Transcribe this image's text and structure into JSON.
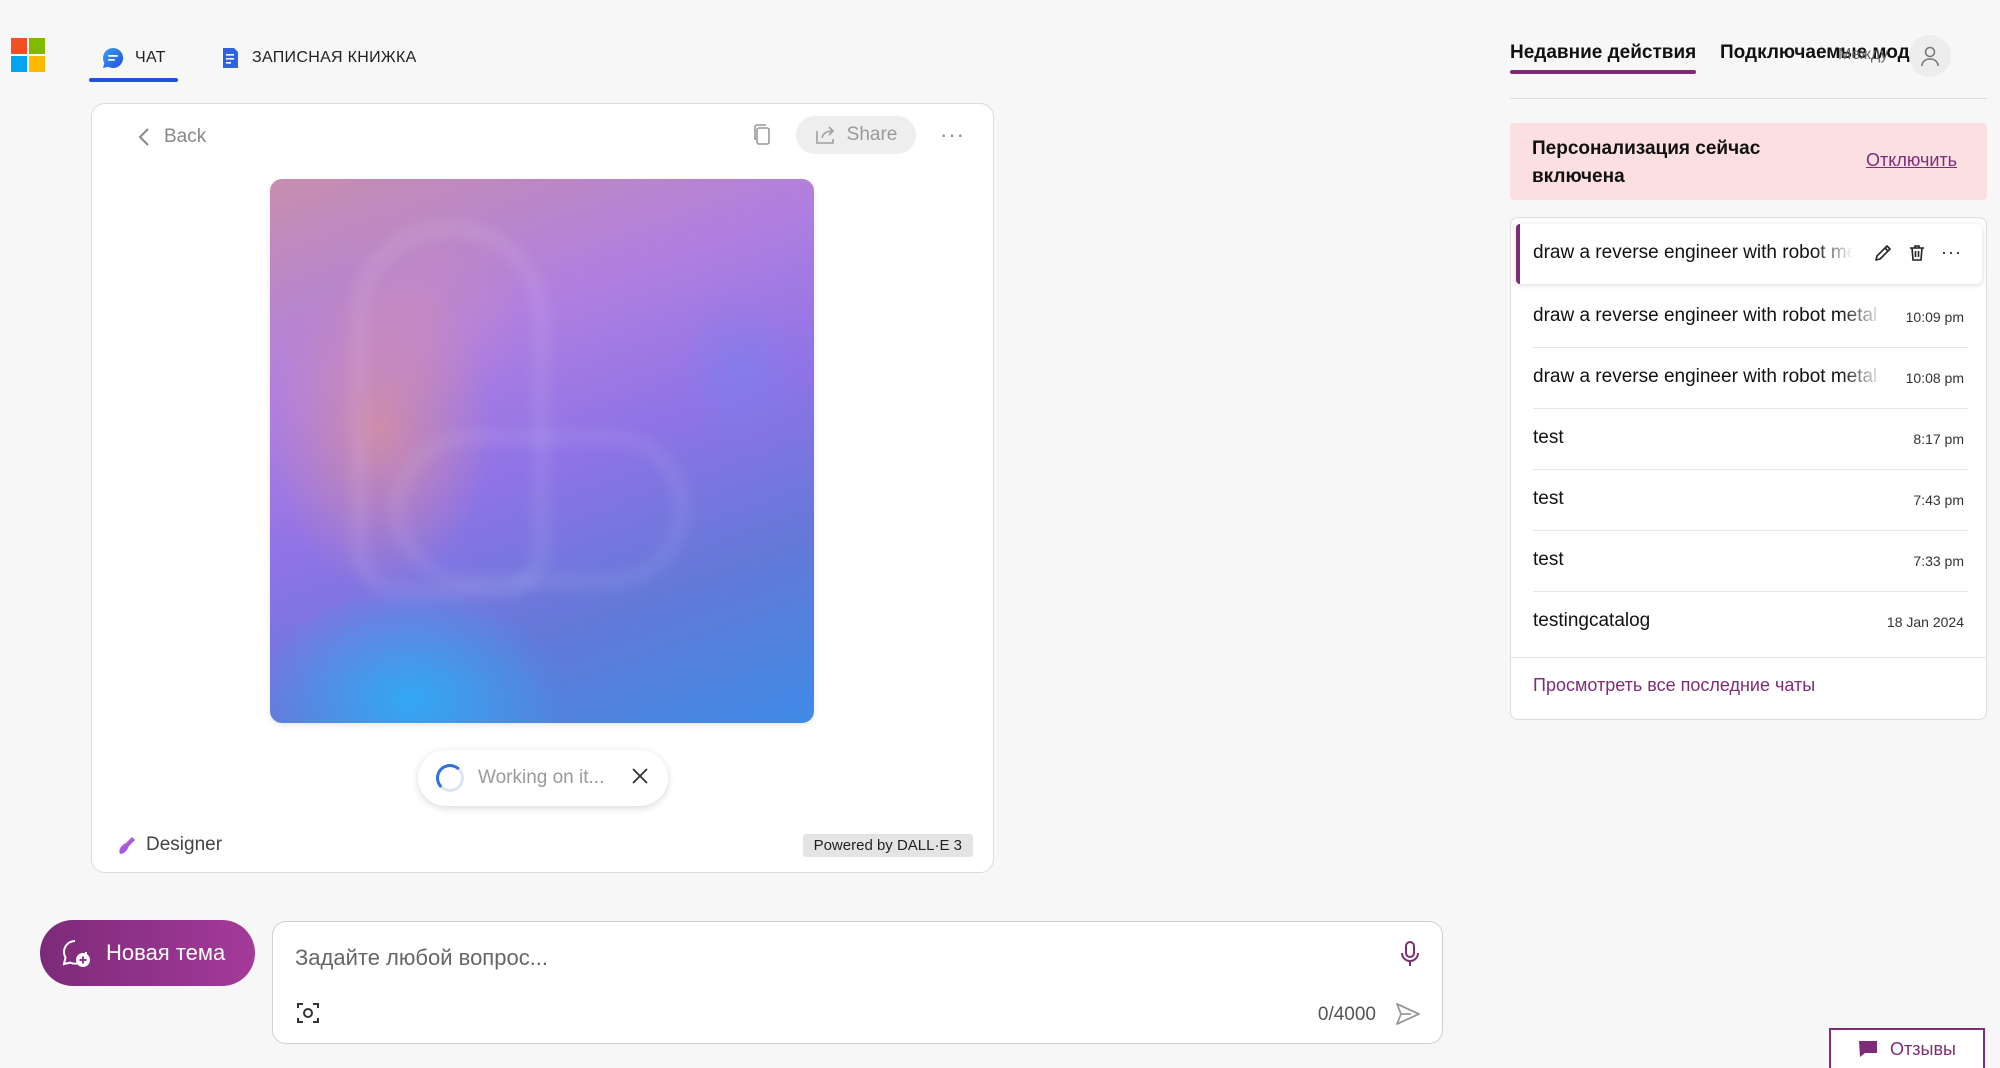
{
  "header": {
    "tabs": [
      {
        "label": "ЧАТ",
        "active": true,
        "icon": "chat-bubble-icon"
      },
      {
        "label": "ЗАПИСНАЯ КНИЖКА",
        "active": false,
        "icon": "notebook-icon"
      }
    ],
    "logo_colors": [
      "#f25022",
      "#7fba00",
      "#00a4ef",
      "#ffb900"
    ]
  },
  "card": {
    "back_label": "Back",
    "share_label": "Share",
    "working_label": "Working on it...",
    "designer_label": "Designer",
    "powered_label": "Powered by DALL·E 3"
  },
  "composer": {
    "new_topic_label": "Новая тема",
    "placeholder": "Задайте любой вопрос...",
    "counter": "0/4000"
  },
  "right_panel": {
    "tabs": [
      {
        "label": "Недавние действия",
        "active": true
      },
      {
        "label": "Подключаемые модули",
        "active": false
      }
    ],
    "overlap_text": "Между",
    "personalization": {
      "text": "Персонализация сейчас включена",
      "action": "Отключить"
    },
    "history": [
      {
        "title": "draw a reverse engineer with robot metal parts",
        "time": "",
        "selected": true
      },
      {
        "title": "draw a reverse engineer with robot metal parts",
        "time": "10:09 pm"
      },
      {
        "title": "draw a reverse engineer with robot metal parts",
        "time": "10:08 pm"
      },
      {
        "title": "test",
        "time": "8:17 pm"
      },
      {
        "title": "test",
        "time": "7:43 pm"
      },
      {
        "title": "test",
        "time": "7:33 pm"
      },
      {
        "title": "testingcatalog",
        "time": "18 Jan 2024"
      }
    ],
    "view_all": "Просмотреть все последние чаты"
  },
  "feedback_label": "Отзывы",
  "colors": {
    "accent": "#7f2c78",
    "nav_active": "#2450d8",
    "persona_bg": "#fbdfe1"
  }
}
